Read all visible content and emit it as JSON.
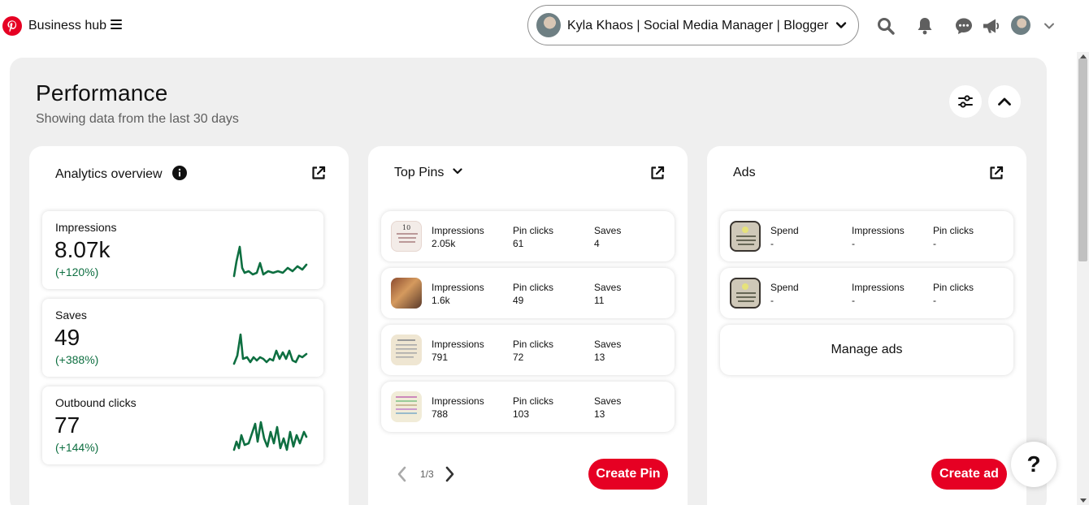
{
  "topbar": {
    "title": "Business hub",
    "account_name": "Kyla Khaos | Social Media Manager | Blogger",
    "icons": [
      "pinterest-logo-icon",
      "menu-icon",
      "search-icon",
      "bell-icon",
      "messages-icon",
      "megaphone-icon",
      "avatar",
      "chevron-down-icon"
    ]
  },
  "performance": {
    "title": "Performance",
    "subtitle": "Showing data from the last 30 days"
  },
  "analytics": {
    "title": "Analytics overview",
    "metrics": [
      {
        "label": "Impressions",
        "value": "8.07k",
        "change": "(+120%)"
      },
      {
        "label": "Saves",
        "value": "49",
        "change": "(+388%)"
      },
      {
        "label": "Outbound clicks",
        "value": "77",
        "change": "(+144%)"
      }
    ]
  },
  "top_pins": {
    "title": "Top Pins",
    "rows": [
      {
        "impressions_label": "Impressions",
        "impressions": "2.05k",
        "clicks_label": "Pin clicks",
        "clicks": "61",
        "saves_label": "Saves",
        "saves": "4"
      },
      {
        "impressions_label": "Impressions",
        "impressions": "1.6k",
        "clicks_label": "Pin clicks",
        "clicks": "49",
        "saves_label": "Saves",
        "saves": "11"
      },
      {
        "impressions_label": "Impressions",
        "impressions": "791",
        "clicks_label": "Pin clicks",
        "clicks": "72",
        "saves_label": "Saves",
        "saves": "13"
      },
      {
        "impressions_label": "Impressions",
        "impressions": "788",
        "clicks_label": "Pin clicks",
        "clicks": "103",
        "saves_label": "Saves",
        "saves": "13"
      }
    ],
    "pager": "1/3",
    "create_label": "Create Pin"
  },
  "ads": {
    "title": "Ads",
    "rows": [
      {
        "spend_label": "Spend",
        "spend": "-",
        "impressions_label": "Impressions",
        "impressions": "-",
        "clicks_label": "Pin clicks",
        "clicks": "-"
      },
      {
        "spend_label": "Spend",
        "spend": "-",
        "impressions_label": "Impressions",
        "impressions": "-",
        "clicks_label": "Pin clicks",
        "clicks": "-"
      }
    ],
    "manage_label": "Manage ads",
    "create_label": "Create ad"
  },
  "help": {
    "label": "?"
  },
  "colors": {
    "brand_red": "#e60023",
    "positive_green": "#0e6f41",
    "panel_gray": "#efefef"
  }
}
